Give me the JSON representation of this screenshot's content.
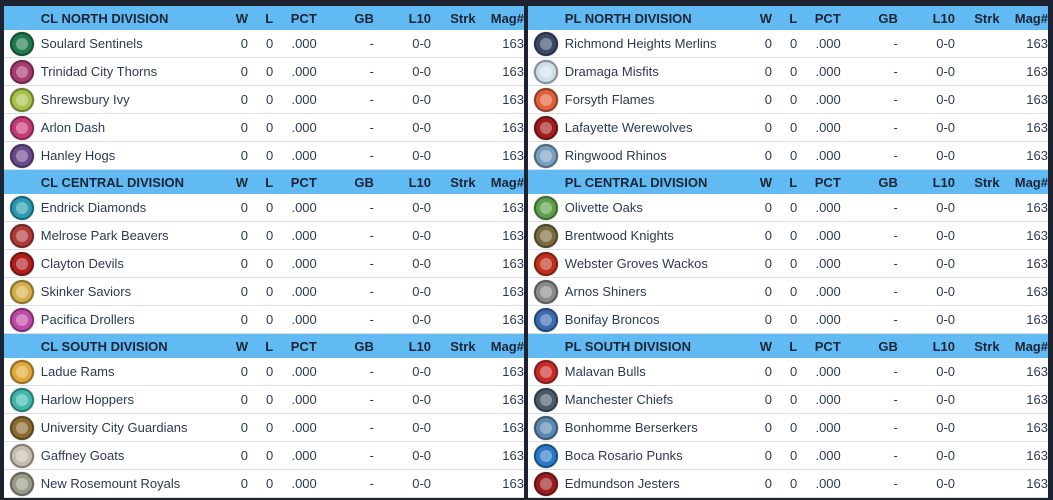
{
  "columns": {
    "w": "W",
    "l": "L",
    "pct": "PCT",
    "gb": "GB",
    "l10": "L10",
    "strk": "Strk",
    "mag": "Mag#"
  },
  "left": [
    {
      "division": "CL NORTH DIVISION",
      "teams": [
        {
          "name": "Soulard Sentinels",
          "logo_color": "#1f7a4f",
          "logo_icon": "sentinel-logo-icon",
          "w": "0",
          "l": "0",
          "pct": ".000",
          "gb": "-",
          "l10": "0-0",
          "strk": "",
          "mag": "163"
        },
        {
          "name": "Trinidad City Thorns",
          "logo_color": "#a83a6e",
          "logo_icon": "thorns-logo-icon",
          "w": "0",
          "l": "0",
          "pct": ".000",
          "gb": "-",
          "l10": "0-0",
          "strk": "",
          "mag": "163"
        },
        {
          "name": "Shrewsbury Ivy",
          "logo_color": "#a6c24a",
          "logo_icon": "ivy-logo-icon",
          "w": "0",
          "l": "0",
          "pct": ".000",
          "gb": "-",
          "l10": "0-0",
          "strk": "",
          "mag": "163"
        },
        {
          "name": "Arlon Dash",
          "logo_color": "#c73c78",
          "logo_icon": "dash-logo-icon",
          "w": "0",
          "l": "0",
          "pct": ".000",
          "gb": "-",
          "l10": "0-0",
          "strk": "",
          "mag": "163"
        },
        {
          "name": "Hanley Hogs",
          "logo_color": "#6b4a8a",
          "logo_icon": "hogs-logo-icon",
          "w": "0",
          "l": "0",
          "pct": ".000",
          "gb": "-",
          "l10": "0-0",
          "strk": "",
          "mag": "163"
        }
      ]
    },
    {
      "division": "CL CENTRAL DIVISION",
      "teams": [
        {
          "name": "Endrick Diamonds",
          "logo_color": "#2a9bb0",
          "logo_icon": "diamond-logo-icon",
          "w": "0",
          "l": "0",
          "pct": ".000",
          "gb": "-",
          "l10": "0-0",
          "strk": "",
          "mag": "163"
        },
        {
          "name": "Melrose Park Beavers",
          "logo_color": "#b03a3a",
          "logo_icon": "beaver-logo-icon",
          "w": "0",
          "l": "0",
          "pct": ".000",
          "gb": "-",
          "l10": "0-0",
          "strk": "",
          "mag": "163"
        },
        {
          "name": "Clayton Devils",
          "logo_color": "#b01e1e",
          "logo_icon": "devil-logo-icon",
          "w": "0",
          "l": "0",
          "pct": ".000",
          "gb": "-",
          "l10": "0-0",
          "strk": "",
          "mag": "163"
        },
        {
          "name": "Skinker Saviors",
          "logo_color": "#d4b04a",
          "logo_icon": "halo-logo-icon",
          "w": "0",
          "l": "0",
          "pct": ".000",
          "gb": "-",
          "l10": "0-0",
          "strk": "",
          "mag": "163"
        },
        {
          "name": "Pacifica Drollers",
          "logo_color": "#c04aa8",
          "logo_icon": "droller-logo-icon",
          "w": "0",
          "l": "0",
          "pct": ".000",
          "gb": "-",
          "l10": "0-0",
          "strk": "",
          "mag": "163"
        }
      ]
    },
    {
      "division": "CL SOUTH DIVISION",
      "teams": [
        {
          "name": "Ladue Rams",
          "logo_color": "#e2a838",
          "logo_icon": "ram-logo-icon",
          "w": "0",
          "l": "0",
          "pct": ".000",
          "gb": "-",
          "l10": "0-0",
          "strk": "",
          "mag": "163"
        },
        {
          "name": "Harlow Hoppers",
          "logo_color": "#3fb8ac",
          "logo_icon": "hopper-logo-icon",
          "w": "0",
          "l": "0",
          "pct": ".000",
          "gb": "-",
          "l10": "0-0",
          "strk": "",
          "mag": "163"
        },
        {
          "name": "University City Guardians",
          "logo_color": "#8a6a30",
          "logo_icon": "guardian-logo-icon",
          "w": "0",
          "l": "0",
          "pct": ".000",
          "gb": "-",
          "l10": "0-0",
          "strk": "",
          "mag": "163"
        },
        {
          "name": "Gaffney Goats",
          "logo_color": "#c8beb0",
          "logo_icon": "goat-logo-icon",
          "w": "0",
          "l": "0",
          "pct": ".000",
          "gb": "-",
          "l10": "0-0",
          "strk": "",
          "mag": "163"
        },
        {
          "name": "New Rosemount Royals",
          "logo_color": "#9a9a88",
          "logo_icon": "dragon-logo-icon",
          "w": "0",
          "l": "0",
          "pct": ".000",
          "gb": "-",
          "l10": "0-0",
          "strk": "",
          "mag": "163"
        }
      ]
    }
  ],
  "right": [
    {
      "division": "PL NORTH DIVISION",
      "teams": [
        {
          "name": "Richmond Heights Merlins",
          "logo_color": "#3a4a6a",
          "logo_icon": "merlin-logo-icon",
          "w": "0",
          "l": "0",
          "pct": ".000",
          "gb": "-",
          "l10": "0-0",
          "strk": "",
          "mag": "163"
        },
        {
          "name": "Dramaga Misfits",
          "logo_color": "#cfe0ea",
          "logo_icon": "misfit-logo-icon",
          "w": "0",
          "l": "0",
          "pct": ".000",
          "gb": "-",
          "l10": "0-0",
          "strk": "",
          "mag": "163"
        },
        {
          "name": "Forsyth Flames",
          "logo_color": "#e0603a",
          "logo_icon": "flame-logo-icon",
          "w": "0",
          "l": "0",
          "pct": ".000",
          "gb": "-",
          "l10": "0-0",
          "strk": "",
          "mag": "163"
        },
        {
          "name": "Lafayette Werewolves",
          "logo_color": "#a01e1e",
          "logo_icon": "werewolf-logo-icon",
          "w": "0",
          "l": "0",
          "pct": ".000",
          "gb": "-",
          "l10": "0-0",
          "strk": "",
          "mag": "163"
        },
        {
          "name": "Ringwood Rhinos",
          "logo_color": "#7aa0c0",
          "logo_icon": "rhino-logo-icon",
          "w": "0",
          "l": "0",
          "pct": ".000",
          "gb": "-",
          "l10": "0-0",
          "strk": "",
          "mag": "163"
        }
      ]
    },
    {
      "division": "PL CENTRAL DIVISION",
      "teams": [
        {
          "name": "Olivette Oaks",
          "logo_color": "#5ea04a",
          "logo_icon": "oak-logo-icon",
          "w": "0",
          "l": "0",
          "pct": ".000",
          "gb": "-",
          "l10": "0-0",
          "strk": "",
          "mag": "163"
        },
        {
          "name": "Brentwood Knights",
          "logo_color": "#7a6a40",
          "logo_icon": "knight-logo-icon",
          "w": "0",
          "l": "0",
          "pct": ".000",
          "gb": "-",
          "l10": "0-0",
          "strk": "",
          "mag": "163"
        },
        {
          "name": "Webster Groves Wackos",
          "logo_color": "#c0301e",
          "logo_icon": "wacko-logo-icon",
          "w": "0",
          "l": "0",
          "pct": ".000",
          "gb": "-",
          "l10": "0-0",
          "strk": "",
          "mag": "163"
        },
        {
          "name": "Arnos Shiners",
          "logo_color": "#8a8a8a",
          "logo_icon": "shiner-logo-icon",
          "w": "0",
          "l": "0",
          "pct": ".000",
          "gb": "-",
          "l10": "0-0",
          "strk": "",
          "mag": "163"
        },
        {
          "name": "Bonifay Broncos",
          "logo_color": "#3a6ab0",
          "logo_icon": "bronco-logo-icon",
          "w": "0",
          "l": "0",
          "pct": ".000",
          "gb": "-",
          "l10": "0-0",
          "strk": "",
          "mag": "163"
        }
      ]
    },
    {
      "division": "PL SOUTH DIVISION",
      "teams": [
        {
          "name": "Malavan Bulls",
          "logo_color": "#c82a2a",
          "logo_icon": "bull-logo-icon",
          "w": "0",
          "l": "0",
          "pct": ".000",
          "gb": "-",
          "l10": "0-0",
          "strk": "",
          "mag": "163"
        },
        {
          "name": "Manchester Chiefs",
          "logo_color": "#4a5a6a",
          "logo_icon": "chief-logo-icon",
          "w": "0",
          "l": "0",
          "pct": ".000",
          "gb": "-",
          "l10": "0-0",
          "strk": "",
          "mag": "163"
        },
        {
          "name": "Bonhomme Berserkers",
          "logo_color": "#5a88b0",
          "logo_icon": "berserker-logo-icon",
          "w": "0",
          "l": "0",
          "pct": ".000",
          "gb": "-",
          "l10": "0-0",
          "strk": "",
          "mag": "163"
        },
        {
          "name": "Boca Rosario Punks",
          "logo_color": "#2a7ac8",
          "logo_icon": "punk-flame-logo-icon",
          "w": "0",
          "l": "0",
          "pct": ".000",
          "gb": "-",
          "l10": "0-0",
          "strk": "",
          "mag": "163"
        },
        {
          "name": "Edmundson Jesters",
          "logo_color": "#9a1e1e",
          "logo_icon": "jester-logo-icon",
          "w": "0",
          "l": "0",
          "pct": ".000",
          "gb": "-",
          "l10": "0-0",
          "strk": "",
          "mag": "163"
        }
      ]
    }
  ]
}
